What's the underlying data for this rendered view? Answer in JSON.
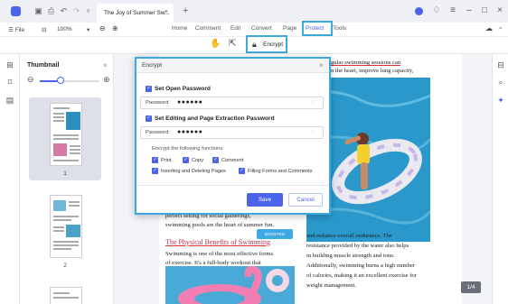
{
  "titlebar": {
    "doc_tab_title": "The Joy of Summer Sw...",
    "doc_tab_close": "×",
    "new_tab": "+",
    "window_controls": [
      "–",
      "□",
      "×"
    ],
    "accent_color": "#4a63e8"
  },
  "menubar": {
    "file_label": "☰ File",
    "zoom_value": "100%",
    "zoom_dropdown": "▾",
    "zoom_out_icon": "⊖",
    "zoom_in_icon": "⊕",
    "menus": [
      "Home",
      "Comment",
      "Edit",
      "Convert",
      "Page",
      "Protect",
      "Tools"
    ],
    "active_menu": "Protect"
  },
  "subbar": {
    "encrypt_label": "Encrypt"
  },
  "thumbnails": {
    "title": "Thumbnail",
    "close": "×",
    "zoom_level": 0.35,
    "pages": [
      {
        "number": "1",
        "selected": true
      },
      {
        "number": "2",
        "selected": false
      }
    ]
  },
  "document": {
    "right_col_top": [
      "gular swimming sessions can",
      "n the heart, improve lung capacity,"
    ],
    "left_col": [
      "perfect setting for social gatherings,",
      "swimming pools are the heart of summer fun."
    ],
    "heading": "The Physical Benefits of Swimming",
    "left_body": [
      "Swimming is one of the most effective forms",
      "of exercise. It's a full-body workout that"
    ],
    "right_body": [
      "and enhance overall endurance. The",
      "resistance provided by the water also helps",
      "in building muscle strength and tone.",
      "Additionally, swimming burns a high number",
      "of calories, making it an excellent exercise for",
      "weight management."
    ],
    "badge": "BOOSTED",
    "page_counter": "1/4"
  },
  "dialog": {
    "title": "Encrypt",
    "close": "×",
    "open_password_heading": "Set Open Password",
    "open_password_label": "Password",
    "open_password_value": "●●●●●●",
    "edit_password_heading": "Set Editing and Page Extraction Password",
    "edit_password_label": "Password",
    "edit_password_value": "●●●●●●",
    "functions_heading": "Encrypt the following functions:",
    "permissions": [
      "Print",
      "Copy",
      "Comment",
      "Inserting and Deleting Pages",
      "Filling Forms and Comments"
    ],
    "save_label": "Save",
    "cancel_label": "Cancel",
    "check_mark": "✓",
    "eye_icon": "◌"
  }
}
